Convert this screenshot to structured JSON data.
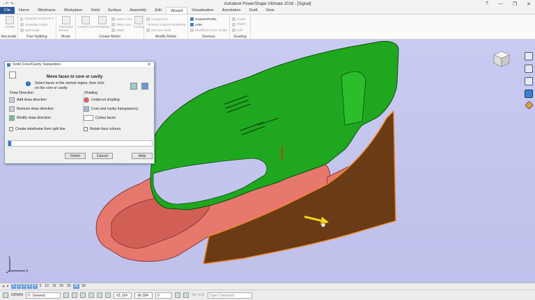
{
  "window": {
    "title": "Autodesk PowerShape Ultimate 2018 - [Signal]",
    "quick_access": "- ↶ ↷ -",
    "controls": [
      "?",
      "—",
      "❐",
      "✕"
    ]
  },
  "tabs": [
    "File",
    "Home",
    "Wireframe",
    "Workplane",
    "Solid",
    "Surface",
    "Assembly",
    "Edit",
    "Wizard",
    "Visualisation",
    "Annotation",
    "Draft",
    "View"
  ],
  "active_tab": "Wizard",
  "ribbon": {
    "groups": [
      {
        "label": "Electrode",
        "big": "Create"
      },
      {
        "label": "Part Splitting",
        "items": [
          "Separate Surfaces ▾",
          "Separate Solids",
          "Split Solid"
        ]
      },
      {
        "label": "Mode",
        "big": "Toolmaker Wizard"
      },
      {
        "label": "Create Molds",
        "items": [
          "Cavity/Core",
          "Workplane",
          "Shutoff",
          "Ejector",
          "Runner Insert"
        ],
        "extra": [
          "Insert Lock",
          "Slide Core",
          "Slider",
          "Cooling"
        ]
      },
      {
        "label": "Modify Molds",
        "items": [
          "Component",
          "Restore Feature Modelling",
          "Remove Mold"
        ]
      },
      {
        "label": "Devices",
        "items": [
          "Scanner/Probe",
          "Artec",
          "Shortlines From Inside"
        ]
      },
      {
        "label": "Grading",
        "items": [
          "Grade",
          "Pixel ▾",
          "Edit"
        ]
      }
    ]
  },
  "dialog": {
    "title": "Solid Core/Cavity Separation",
    "heading": "Move faces to core or cavity",
    "description": "Select faces in the central region, then click on the core or cavity",
    "draw_direction": {
      "label": "Draw Direction",
      "items": [
        "Add draw direction",
        "Remove draw direction",
        "Modify draw direction"
      ]
    },
    "shading": {
      "label": "Shading",
      "items": [
        "Undercut shading",
        "Core and cavity transparency",
        "Colour faces"
      ]
    },
    "checkbox_wireframe": "Create wireframe from split line",
    "checkbox_retain": "Retain face colours",
    "progress": 0.02,
    "buttons": {
      "finish": "Finish",
      "cancel": "Cancel",
      "help": "Help"
    }
  },
  "status": {
    "levels": [
      "0",
      "1",
      "2",
      "3",
      "4",
      "5",
      "10",
      "15",
      "20",
      "25",
      "30",
      "35"
    ],
    "active_levels": [
      "0",
      "1",
      "2",
      "3",
      "4",
      "30"
    ]
  },
  "bottom": {
    "units": "DDWIN",
    "workplane": "0 : General",
    "coord_x": "-91.154",
    "coord_y": "-96.384",
    "coord_z": "0",
    "tolerance": "Tol: 0.01",
    "command_placeholder": "Type Command"
  },
  "colors": {
    "file_tab": "#2b579a",
    "cavity": "#1fa81f",
    "core": "#e6786e",
    "plate": "#6b3b16",
    "viewport": "#c4c5ee"
  }
}
